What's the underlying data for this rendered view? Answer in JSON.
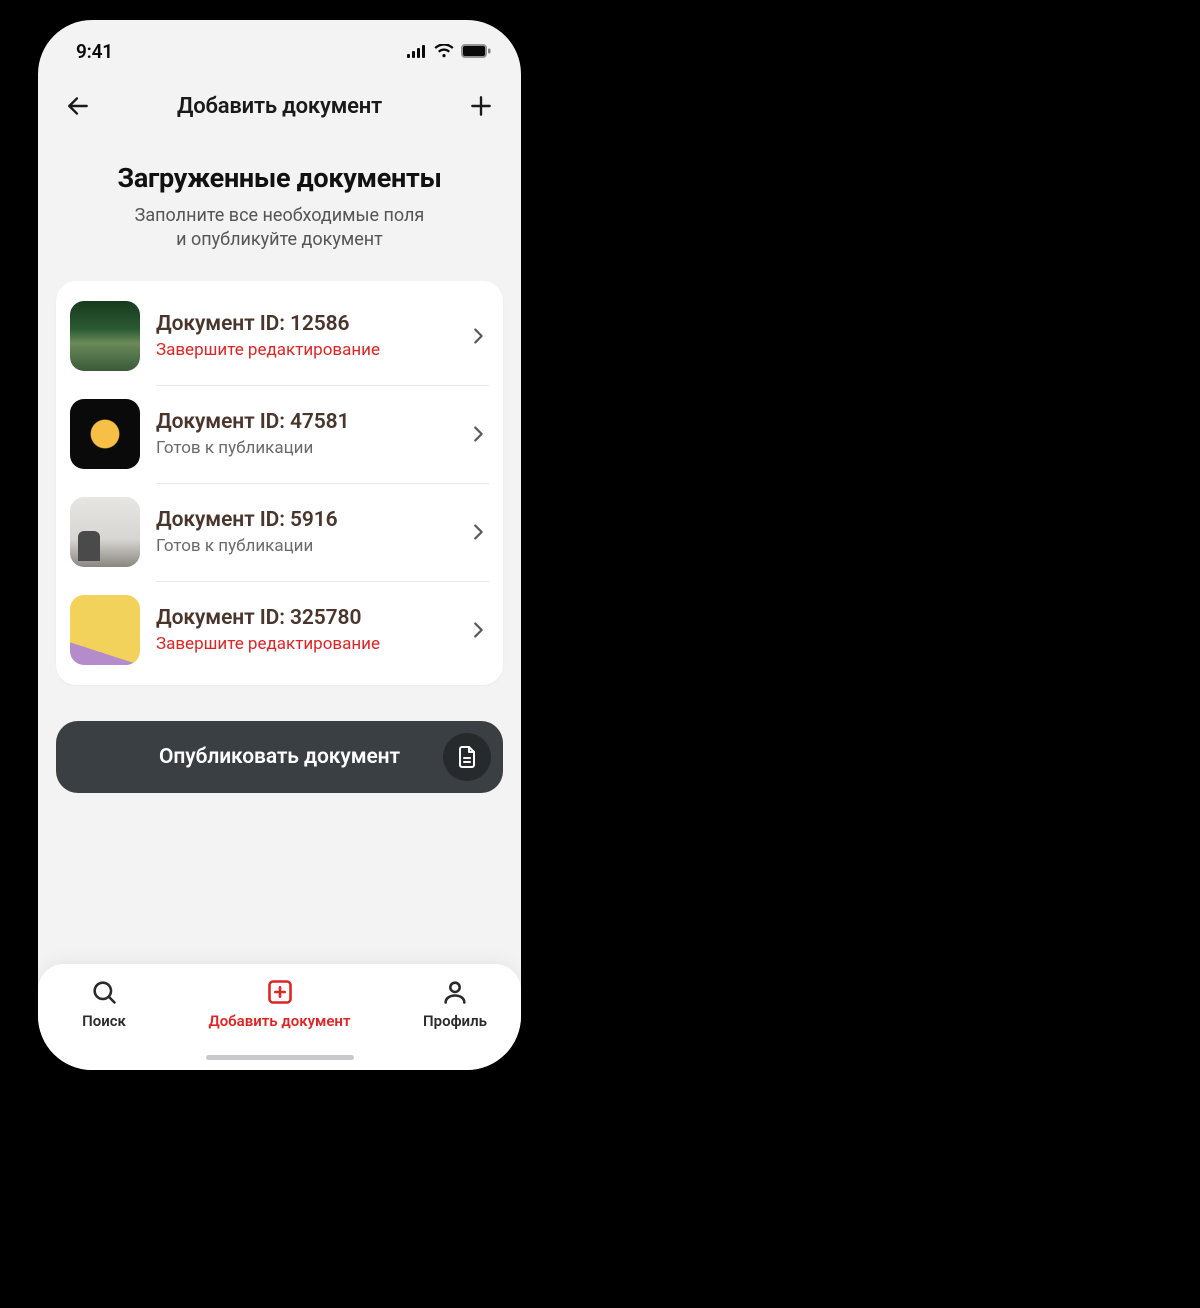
{
  "status_bar": {
    "time": "9:41"
  },
  "header": {
    "title": "Добавить документ"
  },
  "page": {
    "title": "Загруженные документы",
    "subtitle_line1": "Заполните все необходимые поля",
    "subtitle_line2": "и опубликуйте документ"
  },
  "documents": [
    {
      "title": "Документ ID: 12586",
      "status": "Завершите редактирование",
      "status_kind": "warn",
      "thumb": "forest"
    },
    {
      "title": "Документ ID: 47581",
      "status": "Готов к публикации",
      "status_kind": "ready",
      "thumb": "moon"
    },
    {
      "title": "Документ ID: 5916",
      "status": "Готов к публикации",
      "status_kind": "ready",
      "thumb": "statue"
    },
    {
      "title": "Документ ID: 325780",
      "status": "Завершите редактирование",
      "status_kind": "warn",
      "thumb": "macarons"
    }
  ],
  "publish": {
    "label": "Опубликовать документ"
  },
  "tabs": {
    "search": {
      "label": "Поиск"
    },
    "add": {
      "label": "Добавить документ"
    },
    "profile": {
      "label": "Профиль"
    }
  },
  "colors": {
    "accent": "#e02424",
    "text_brown": "#4a352c",
    "button_bg": "#3a3f43"
  }
}
